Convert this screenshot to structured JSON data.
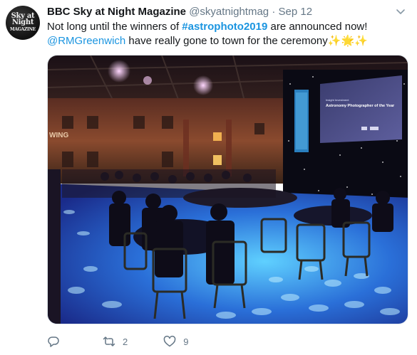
{
  "tweet": {
    "avatar_text": "Sky at Night",
    "avatar_sub": "MAGAZINE",
    "author_name": "BBC Sky at Night Magazine",
    "handle": "@skyatnightmag",
    "separator": "·",
    "date": "Sep 12",
    "text_pre": "Not long until the winners of ",
    "hashtag": "#astrophoto2019",
    "text_post": " are announced now!",
    "mention": "@RMGreenwich",
    "text_line2": " have really gone to town for the ceremony",
    "sparkles": "✨🌟✨",
    "screen_title": "Astronomy Photographer of the Year",
    "screen_small": "Insight Investment",
    "wall_text": "WING"
  },
  "actions": {
    "reply_count": "",
    "retweet_count": "2",
    "like_count": "9"
  },
  "colors": {
    "link": "#1b95e0",
    "text": "#14171a",
    "muted": "#657786"
  }
}
